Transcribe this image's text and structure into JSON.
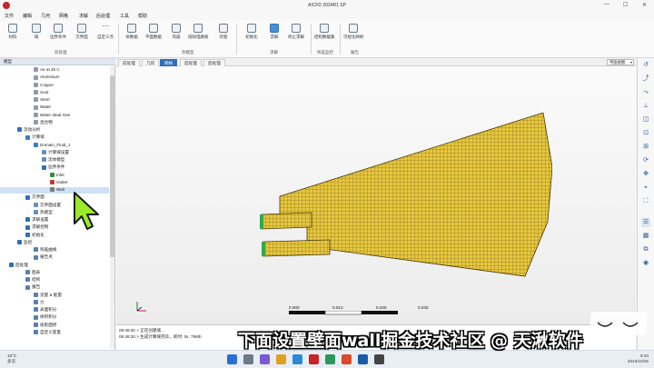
{
  "window": {
    "title": "AICFD 2024R1 SP",
    "min": "—",
    "max": "☐",
    "close": "✕"
  },
  "menu": [
    "文件",
    "编辑",
    "几何",
    "网格",
    "求解",
    "后处理",
    "工具",
    "帮助"
  ],
  "ribbon": {
    "buttons": [
      "材料",
      "域",
      "边界条件",
      "交界面",
      "自定义点",
      "体数据",
      "平面数据",
      "风扇",
      "排除电路板",
      "热管",
      "初始化",
      "求解",
      "停止求解",
      "结构数据集",
      "可视化映射"
    ],
    "groups": [
      "前处理",
      "热模型",
      "求解",
      "残差监控",
      "报告"
    ]
  },
  "left_panel": {
    "header": "模型",
    "tree": [
      {
        "label": "Air at 25 C",
        "indent": 3,
        "icon": "material-icon"
      },
      {
        "label": "Aluminium",
        "indent": 3,
        "icon": "material-icon"
      },
      {
        "label": "Copper",
        "indent": 3,
        "icon": "material-icon"
      },
      {
        "label": "Soot",
        "indent": 3,
        "icon": "material-icon"
      },
      {
        "label": "Steel",
        "indent": 3,
        "icon": "material-icon"
      },
      {
        "label": "Water",
        "indent": 3,
        "icon": "material-icon"
      },
      {
        "label": "Water Ideal Gas",
        "indent": 3,
        "icon": "material-icon"
      },
      {
        "label": "混合物",
        "indent": 3,
        "icon": "material-icon"
      },
      {
        "label": "流动分析",
        "indent": 1,
        "icon": "analysis-icon"
      },
      {
        "label": "计算域",
        "indent": 2,
        "icon": "domain-icon"
      },
      {
        "label": "Domain_Fluid_1",
        "indent": 3,
        "icon": "domain-icon"
      },
      {
        "label": "计算域设置",
        "indent": 4,
        "icon": "settings-icon"
      },
      {
        "label": "流体模型",
        "indent": 4,
        "icon": "settings-icon"
      },
      {
        "label": "边界条件",
        "indent": 4,
        "icon": "boundary-icon"
      },
      {
        "label": "Inlet",
        "indent": 5,
        "icon": "inlet-icon"
      },
      {
        "label": "Outlet",
        "indent": 5,
        "icon": "outlet-icon"
      },
      {
        "label": "Wall",
        "indent": 5,
        "icon": "wall-icon",
        "selected": true
      },
      {
        "label": "交界面",
        "indent": 2,
        "icon": "interface-icon"
      },
      {
        "label": "交界面设置",
        "indent": 3,
        "icon": "settings-icon"
      },
      {
        "label": "热模型",
        "indent": 3,
        "icon": "settings-icon"
      },
      {
        "label": "求解设置",
        "indent": 2,
        "icon": "solver-icon"
      },
      {
        "label": "求解控制",
        "indent": 2,
        "icon": "solver-icon"
      },
      {
        "label": "初始化",
        "indent": 2,
        "icon": "init-icon"
      },
      {
        "label": "监控",
        "indent": 1,
        "icon": "monitor-icon"
      },
      {
        "label": "残差曲线",
        "indent": 3,
        "icon": "chart-icon"
      },
      {
        "label": "报告点",
        "indent": 3,
        "icon": "chart-icon"
      },
      {
        "label": "后处理",
        "indent": 0,
        "icon": "post-icon"
      },
      {
        "label": "图表",
        "indent": 2,
        "icon": "chart-icon"
      },
      {
        "label": "结构",
        "indent": 2,
        "icon": "chart-icon"
      },
      {
        "label": "报告",
        "indent": 2,
        "icon": "report-icon"
      },
      {
        "label": "流量 & 能量",
        "indent": 3,
        "icon": "report-icon"
      },
      {
        "label": "力",
        "indent": 3,
        "icon": "report-icon"
      },
      {
        "label": "表面积分",
        "indent": 3,
        "icon": "report-icon"
      },
      {
        "label": "体积积分",
        "indent": 3,
        "icon": "report-icon"
      },
      {
        "label": "投影面积",
        "indent": 3,
        "icon": "report-icon"
      },
      {
        "label": "自定义变量",
        "indent": 3,
        "icon": "report-icon"
      }
    ]
  },
  "viewport": {
    "tabs": [
      "前处理",
      "几何",
      "网格",
      "后处理"
    ],
    "active_tab": 2,
    "view_select": "平面视图",
    "scale_labels": [
      "0.000",
      "0.013",
      "0.026",
      "0.040"
    ],
    "mesh_color": "#e3c33c",
    "mesh_line": "#5a4a10"
  },
  "console": {
    "lines": [
      "09:48:30 > 正在创建域...",
      "09:48:30 > 生成计算域完毕，耗时: 0s, 79Mb"
    ]
  },
  "right_toolbar": [
    "reset-view-icon",
    "axis-x-icon",
    "axis-y-icon",
    "axis-z-icon",
    "iso-view-icon",
    "zoom-fit-icon",
    "zoom-area-icon",
    "rotate-icon",
    "pan-icon",
    "select-icon",
    "fit-all-icon",
    "show-mesh-icon",
    "show-surface-icon",
    "screenshot-icon",
    "camera-icon"
  ],
  "taskbar": {
    "weather_temp": "18°C",
    "weather_desc": "多云",
    "time": "9:34",
    "date": "2024/10/25"
  },
  "overlay": {
    "subtitle": "下面设置壁面wall掘金技术社区 @ 天湫软件"
  }
}
